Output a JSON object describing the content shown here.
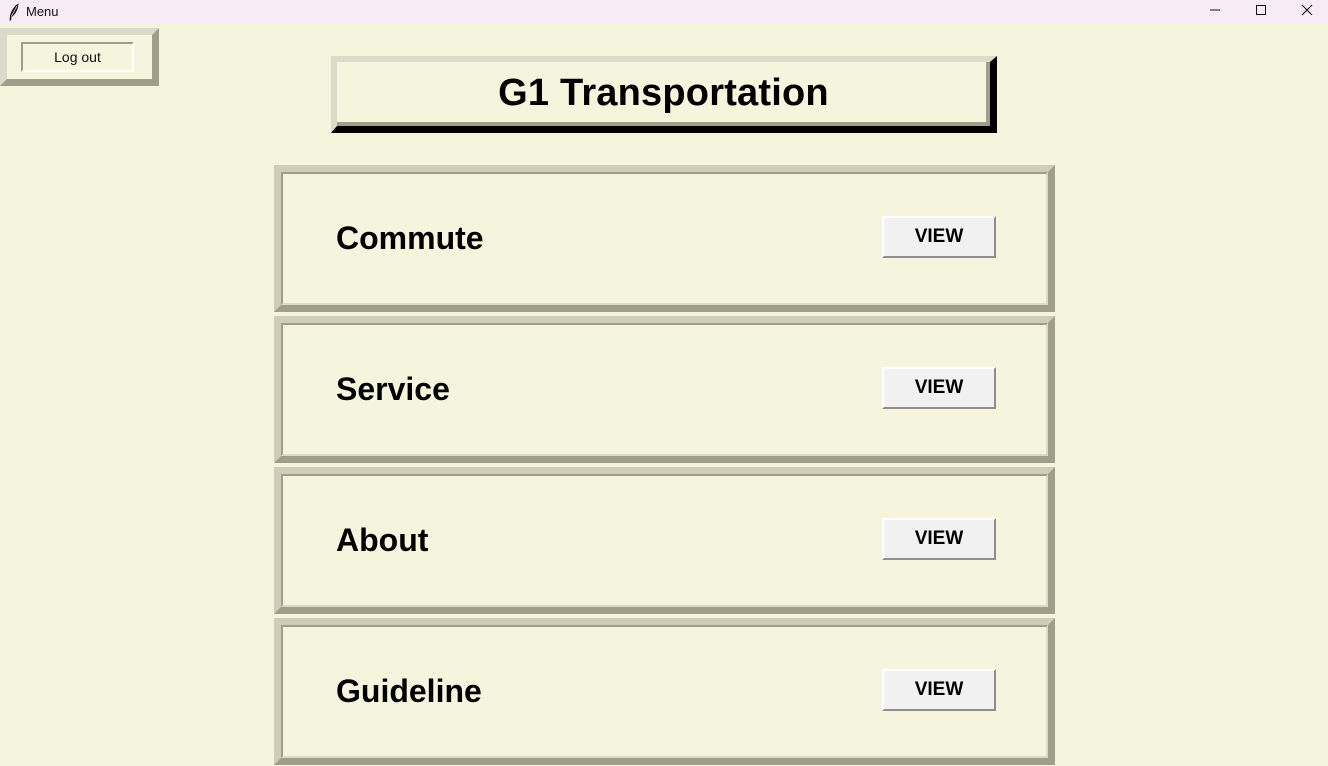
{
  "window": {
    "title": "Menu",
    "app_icon": "feather-icon",
    "controls": {
      "minimize_icon": "minimize-icon",
      "maximize_icon": "maximize-icon",
      "close_icon": "close-icon"
    }
  },
  "header": {
    "logout_label": "Log out",
    "title": "G1 Transportation"
  },
  "sections": [
    {
      "label": "Commute",
      "button_label": "VIEW"
    },
    {
      "label": "Service",
      "button_label": "VIEW"
    },
    {
      "label": "About",
      "button_label": "VIEW"
    },
    {
      "label": "Guideline",
      "button_label": "VIEW"
    }
  ],
  "colors": {
    "background": "#f5f4dc",
    "frame_shadow": "#9f9e89",
    "frame_highlight": "#dcdac8",
    "titlebar": "#f7ecf6",
    "button_face": "#f1f1f1"
  }
}
